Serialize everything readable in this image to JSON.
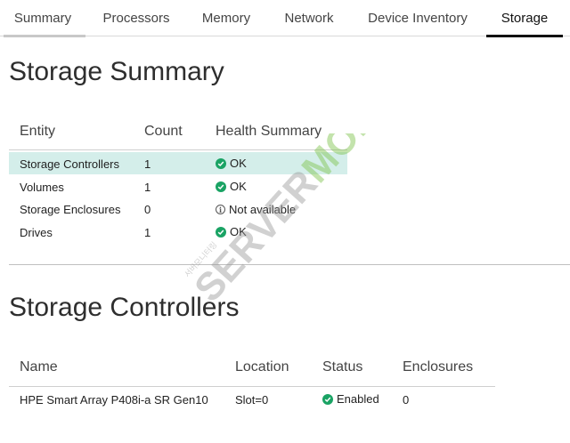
{
  "tabs": [
    {
      "label": "Summary",
      "active": false
    },
    {
      "label": "Processors",
      "active": false
    },
    {
      "label": "Memory",
      "active": false
    },
    {
      "label": "Network",
      "active": false
    },
    {
      "label": "Device Inventory",
      "active": false
    },
    {
      "label": "Storage",
      "active": true
    }
  ],
  "storage_summary": {
    "title": "Storage Summary",
    "columns": [
      "Entity",
      "Count",
      "Health Summary"
    ],
    "rows": [
      {
        "entity": "Storage Controllers",
        "count": "1",
        "health": "OK",
        "status_icon": "ok-check-icon",
        "highlighted": true
      },
      {
        "entity": "Volumes",
        "count": "1",
        "health": "OK",
        "status_icon": "ok-check-icon",
        "highlighted": false
      },
      {
        "entity": "Storage Enclosures",
        "count": "0",
        "health": "Not available",
        "status_icon": "info-icon",
        "highlighted": false
      },
      {
        "entity": "Drives",
        "count": "1",
        "health": "OK",
        "status_icon": "ok-check-icon",
        "highlighted": false
      }
    ]
  },
  "storage_controllers": {
    "title": "Storage Controllers",
    "columns": [
      "Name",
      "Location",
      "Status",
      "Enclosures"
    ],
    "rows": [
      {
        "name": "HPE Smart Array P408i-a SR Gen10",
        "location": "Slot=0",
        "status": "Enabled",
        "status_icon": "ok-check-icon",
        "enclosures": "0"
      }
    ]
  },
  "watermark": {
    "text_gray": "SERVER",
    "text_green": "MON",
    "subtext": "서버모니터링"
  },
  "colors": {
    "ok_green": "#1aa364",
    "row_highlight": "#d4eeea",
    "active_tab": "#111111",
    "watermark_green": "#7cc24a"
  }
}
